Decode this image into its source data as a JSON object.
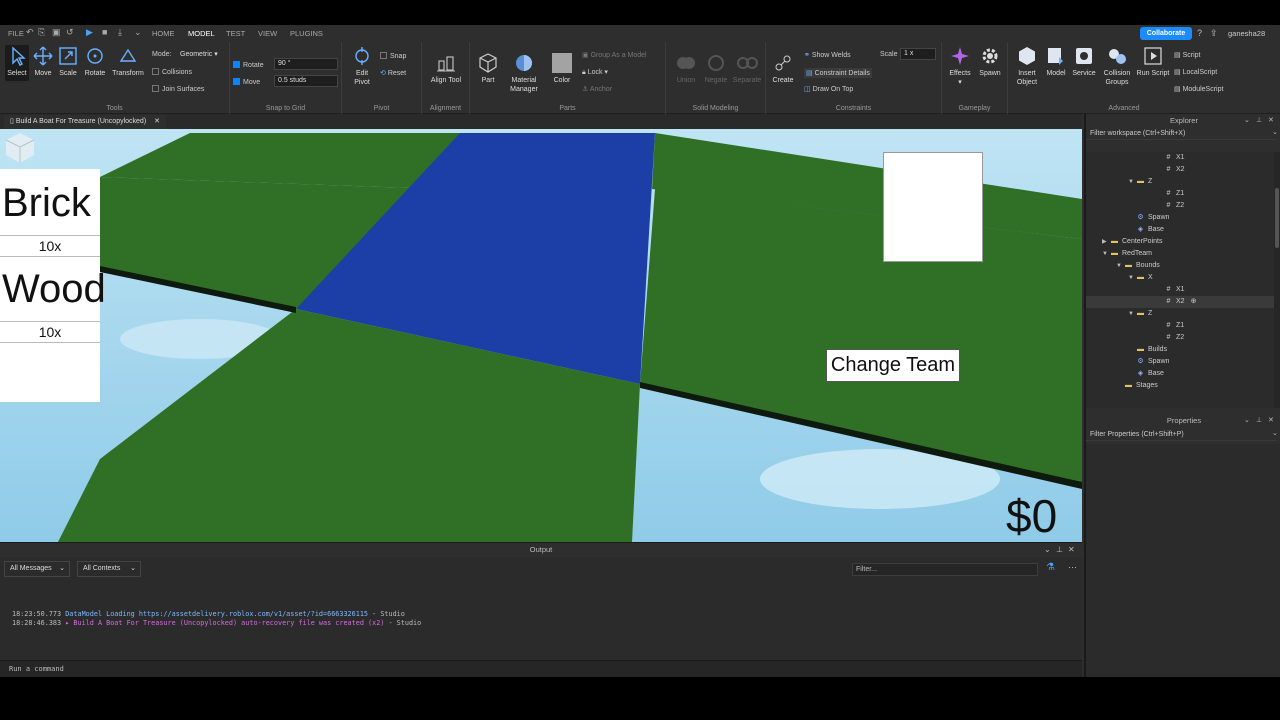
{
  "menubar": {
    "file": "FILE",
    "tabs": [
      "HOME",
      "MODEL",
      "TEST",
      "VIEW",
      "PLUGINS"
    ],
    "active_tab": "MODEL",
    "collaborate": "Collaborate",
    "username": "ganesha28"
  },
  "ribbon": {
    "tools": {
      "label": "Tools",
      "select": "Select",
      "move": "Move",
      "scale": "Scale",
      "rotate": "Rotate",
      "transform": "Transform",
      "mode_label": "Mode:",
      "mode_value": "Geometric",
      "collisions": "Collisions",
      "join_surfaces": "Join Surfaces"
    },
    "snap": {
      "label": "Snap to Grid",
      "rotate_label": "Rotate",
      "rotate_value": "90 °",
      "move_label": "Move",
      "move_value": "0.5 studs"
    },
    "pivot": {
      "label": "Pivot",
      "edit_pivot": "Edit Pivot",
      "snap": "Snap",
      "reset": "Reset"
    },
    "alignment": {
      "label": "Alignment",
      "align_tool": "Align Tool"
    },
    "parts": {
      "label": "Parts",
      "part": "Part",
      "material_manager": "Material Manager",
      "color": "Color",
      "group_as_model": "Group As a Model",
      "lock": "Lock",
      "anchor": "Anchor"
    },
    "solid": {
      "label": "Solid Modeling",
      "union": "Union",
      "negate": "Negate",
      "separate": "Separate"
    },
    "constraints": {
      "label": "Constraints",
      "create": "Create",
      "show_welds": "Show Welds",
      "constraint_details": "Constraint Details",
      "draw_on_top": "Draw On Top",
      "scale_label": "Scale",
      "scale_value": "1 x"
    },
    "gameplay": {
      "label": "Gameplay",
      "effects": "Effects",
      "spawn": "Spawn"
    },
    "advanced": {
      "label": "Advanced",
      "insert_object": "Insert Object",
      "model": "Model",
      "service": "Service",
      "collision_groups": "Collision Groups",
      "run_script": "Run Script",
      "script": "Script",
      "local_script": "LocalScript",
      "module_script": "ModuleScript"
    }
  },
  "document_tab": {
    "title": "Build A Boat For Treasure (Uncopylocked)"
  },
  "viewport": {
    "shop": [
      {
        "name": "Brick",
        "qty": "10x"
      },
      {
        "name": "Wood",
        "qty": "10x"
      }
    ],
    "change_team": "Change Team",
    "money": "$0",
    "colors": {
      "sky": "#9fd3ec",
      "grass": "#2e6e24",
      "blue_team": "#1a3fa8"
    }
  },
  "output": {
    "title": "Output",
    "messages_filter": "All Messages",
    "contexts_filter": "All Contexts",
    "filter_placeholder": "Filter...",
    "logs": [
      {
        "time": "18:23:50.773",
        "text": "DataModel Loading https://assetdelivery.roblox.com/v1/asset/?id=6663326115",
        "source": "Studio",
        "color": "#7fb8ff"
      },
      {
        "time": "18:28:46.383",
        "text": "▸ Build A Boat For Treasure (Uncopylocked) auto-recovery file was created (x2)",
        "source": "Studio",
        "color": "#d96be0"
      }
    ],
    "command_placeholder": "Run a command"
  },
  "explorer": {
    "title": "Explorer",
    "filter_placeholder": "Filter workspace (Ctrl+Shift+X)",
    "items": [
      {
        "label": "X1",
        "icon": "hash",
        "arrow": ""
      },
      {
        "label": "X2",
        "icon": "hash",
        "arrow": ""
      },
      {
        "label": "Z",
        "icon": "folder",
        "arrow": "▼"
      },
      {
        "label": "Z1",
        "icon": "hash",
        "arrow": ""
      },
      {
        "label": "Z2",
        "icon": "hash",
        "arrow": ""
      },
      {
        "label": "Spawn",
        "icon": "spawn",
        "arrow": ""
      },
      {
        "label": "Base",
        "icon": "part",
        "arrow": ""
      },
      {
        "label": "CenterPoints",
        "icon": "folder",
        "arrow": "▶"
      },
      {
        "label": "RedTeam",
        "icon": "folder",
        "arrow": "▼"
      },
      {
        "label": "Bounds",
        "icon": "folder",
        "arrow": "▼"
      },
      {
        "label": "X",
        "icon": "folder",
        "arrow": "▼"
      },
      {
        "label": "X1",
        "icon": "hash",
        "arrow": ""
      },
      {
        "label": "X2",
        "icon": "hash",
        "arrow": ""
      },
      {
        "label": "Z",
        "icon": "folder",
        "arrow": "▼"
      },
      {
        "label": "Z1",
        "icon": "hash",
        "arrow": ""
      },
      {
        "label": "Z2",
        "icon": "hash",
        "arrow": ""
      },
      {
        "label": "Builds",
        "icon": "folder",
        "arrow": ""
      },
      {
        "label": "Spawn",
        "icon": "spawn",
        "arrow": ""
      },
      {
        "label": "Base",
        "icon": "part",
        "arrow": ""
      },
      {
        "label": "Stages",
        "icon": "folder",
        "arrow": ""
      }
    ]
  },
  "properties": {
    "title": "Properties",
    "filter_placeholder": "Filter Properties (Ctrl+Shift+P)"
  }
}
